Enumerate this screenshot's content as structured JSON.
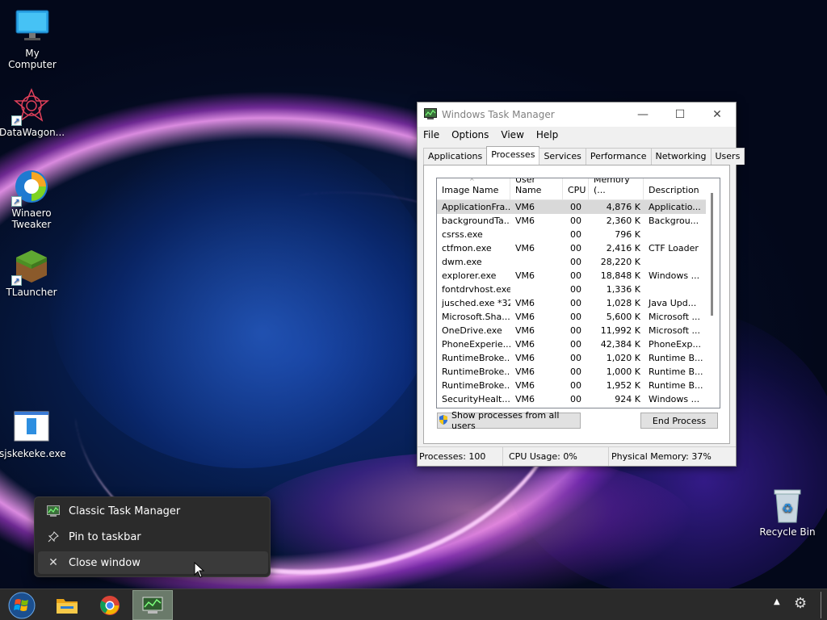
{
  "desktop": {
    "icons": [
      {
        "label": "My Computer"
      },
      {
        "label": "DataWagon..."
      },
      {
        "label": "Winaero Tweaker"
      },
      {
        "label": "TLauncher"
      },
      {
        "label": "sjskekeke.exe"
      },
      {
        "label": "Recycle Bin"
      }
    ]
  },
  "taskmgr": {
    "title": "Windows Task Manager",
    "menu": [
      "File",
      "Options",
      "View",
      "Help"
    ],
    "tabs": [
      "Applications",
      "Processes",
      "Services",
      "Performance",
      "Networking",
      "Users"
    ],
    "active_tab": "Processes",
    "columns": [
      "Image Name",
      "User Name",
      "CPU",
      "Memory (...",
      "Description"
    ],
    "rows": [
      [
        "ApplicationFra...",
        "VM6",
        "00",
        "4,876 K",
        "Applicatio..."
      ],
      [
        "backgroundTa...",
        "VM6",
        "00",
        "2,360 K",
        "Backgrou..."
      ],
      [
        "csrss.exe",
        "",
        "00",
        "796 K",
        ""
      ],
      [
        "ctfmon.exe",
        "VM6",
        "00",
        "2,416 K",
        "CTF Loader"
      ],
      [
        "dwm.exe",
        "",
        "00",
        "28,220 K",
        ""
      ],
      [
        "explorer.exe",
        "VM6",
        "00",
        "18,848 K",
        "Windows ..."
      ],
      [
        "fontdrvhost.exe",
        "",
        "00",
        "1,336 K",
        ""
      ],
      [
        "jusched.exe *32",
        "VM6",
        "00",
        "1,028 K",
        "Java Upd..."
      ],
      [
        "Microsoft.Sha...",
        "VM6",
        "00",
        "5,600 K",
        "Microsoft ..."
      ],
      [
        "OneDrive.exe",
        "VM6",
        "00",
        "11,992 K",
        "Microsoft ..."
      ],
      [
        "PhoneExperie...",
        "VM6",
        "00",
        "42,384 K",
        "PhoneExp..."
      ],
      [
        "RuntimeBroke...",
        "VM6",
        "00",
        "1,020 K",
        "Runtime B..."
      ],
      [
        "RuntimeBroke...",
        "VM6",
        "00",
        "1,000 K",
        "Runtime B..."
      ],
      [
        "RuntimeBroke...",
        "VM6",
        "00",
        "1,952 K",
        "Runtime B..."
      ],
      [
        "SecurityHealt...",
        "VM6",
        "00",
        "924 K",
        "Windows ..."
      ]
    ],
    "show_all_label": "Show processes from all users",
    "end_process_label": "End Process",
    "status": {
      "processes": "Processes: 100",
      "cpu": "CPU Usage: 0%",
      "memory": "Physical Memory: 37%"
    }
  },
  "context_menu": {
    "items": [
      {
        "label": "Classic Task Manager",
        "icon": "task-manager-icon"
      },
      {
        "label": "Pin to taskbar",
        "icon": "pin-icon"
      },
      {
        "label": "Close window",
        "icon": "close-icon"
      }
    ]
  },
  "colors": {
    "selected_row": "#d9d9d9",
    "menu_bg": "#2b2b2b",
    "taskbar_bg": "#2a2a2a"
  }
}
